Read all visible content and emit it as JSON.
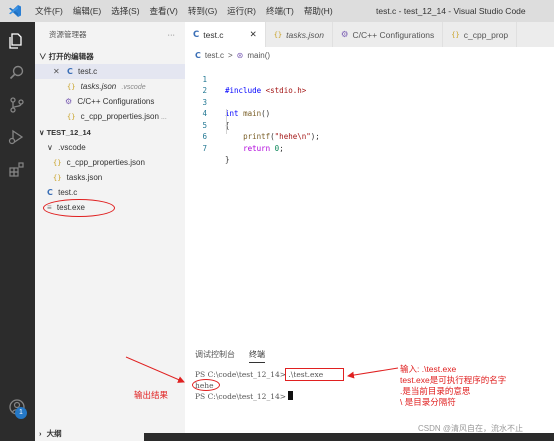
{
  "title_bar": {
    "menu": [
      "文件(F)",
      "编辑(E)",
      "选择(S)",
      "查看(V)",
      "转到(G)",
      "运行(R)",
      "终端(T)",
      "帮助(H)"
    ],
    "window_title": "test.c - test_12_14 - Visual Studio Code"
  },
  "activity_bar": {
    "icons": [
      "explorer-icon",
      "search-icon",
      "source-control-icon",
      "run-debug-icon",
      "extensions-icon",
      "account-icon"
    ],
    "badge": "1"
  },
  "sidebar": {
    "header": "资源管理器",
    "more": "···",
    "open_editors_title": "打开的编辑器",
    "open_editors": [
      {
        "close": "✕",
        "icon": "C",
        "name": "test.c",
        "note": ""
      },
      {
        "icon": "{}",
        "name": "tasks.json",
        "note": ".vscode"
      },
      {
        "icon": "⚙",
        "name": "C/C++ Configurations",
        "note": ""
      },
      {
        "icon": "{}",
        "name": "c_cpp_properties.json",
        "note": "..."
      }
    ],
    "folder_title": "TEST_12_14",
    "folder_items": [
      {
        "icon": "",
        "name": ".vscode"
      },
      {
        "icon": "{}",
        "name": "c_cpp_properties.json"
      },
      {
        "icon": "{}",
        "name": "tasks.json"
      },
      {
        "icon": "C",
        "name": "test.c"
      },
      {
        "icon": "≡",
        "name": "test.exe"
      }
    ],
    "outline_title": "大纲"
  },
  "editor": {
    "tabs": [
      {
        "icon": "C",
        "label": "test.c",
        "close": "✕"
      },
      {
        "icon": "{}",
        "label": "tasks.json"
      },
      {
        "icon": "⚙",
        "label": "C/C++ Configurations"
      },
      {
        "icon": "{}",
        "label": "c_cpp_prop"
      }
    ],
    "breadcrumb": {
      "file": "test.c",
      "sep": ">",
      "symbol": "main()"
    },
    "lines": [
      {
        "n": "1",
        "text": "#include <stdio.h>"
      },
      {
        "n": "2",
        "text": ""
      },
      {
        "n": "3",
        "text": "int main()"
      },
      {
        "n": "4",
        "text": "{"
      },
      {
        "n": "5",
        "text": "    printf(\"hehe\\n\");"
      },
      {
        "n": "6",
        "text": "    return 0;"
      },
      {
        "n": "7",
        "text": "}"
      }
    ]
  },
  "panel": {
    "tabs": [
      "调试控制台",
      "终端"
    ],
    "terminal": {
      "line1_prompt": "PS C:\\code\\test_12_14> ",
      "line1_cmd": ".\\test.exe",
      "line2": "hehe",
      "line3_prompt": "PS C:\\code\\test_12_14> "
    }
  },
  "annotations": {
    "output_label": "输出结果",
    "notes": [
      "输入: .\\test.exe",
      "test.exe是可执行程序的名字",
      ".是当前目录的意思",
      "\\ 是目录分隔符"
    ],
    "color": "#e02020"
  },
  "watermark": "CSDN @清风自在，流水不止"
}
